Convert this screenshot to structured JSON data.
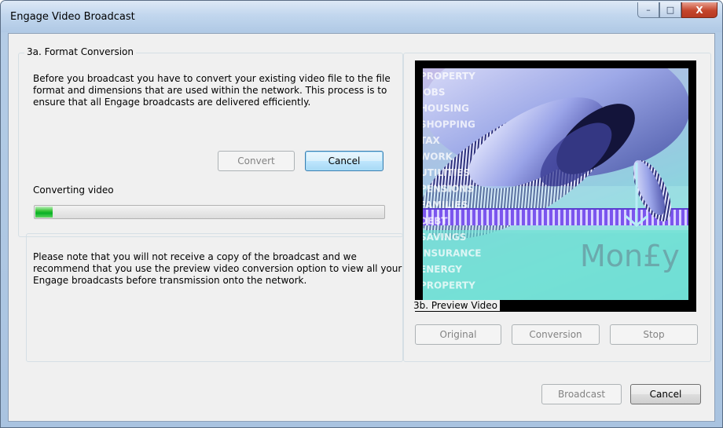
{
  "window": {
    "title": "Engage Video Broadcast",
    "controls": {
      "minimize": "–",
      "maximize": "□",
      "close": "X"
    }
  },
  "format_conversion": {
    "title": "3a. Format Conversion",
    "description": "Before you broadcast you have to convert your existing video file to the file format and dimensions that are used within the network. This process is to ensure that all Engage broadcasts are delivered efficiently.",
    "convert_label": "Convert",
    "cancel_label": "Cancel",
    "status_label": "Converting video",
    "progress_fraction": 0.05
  },
  "note": {
    "text": "Please note that you will not receive a copy of the broadcast and we recommend that you use the preview video conversion option to view all your Engage broadcasts before transmission onto the network."
  },
  "preview": {
    "title": "3b. Preview Video",
    "original_label": "Original",
    "conversion_label": "Conversion",
    "stop_label": "Stop",
    "frame_words": [
      "PROPERTY",
      "JOBS",
      "HOUSING",
      "SHOPPING",
      "TAX",
      "WORK",
      "UTILITIES",
      "PENSIONS",
      "FAMILIES",
      "DEBT",
      "SAVINGS",
      "INSURANCE",
      "ENERGY",
      "PROPERTY"
    ],
    "money_text": "Mon£y"
  },
  "footer": {
    "broadcast_label": "Broadcast",
    "cancel_label": "Cancel"
  },
  "colors": {
    "progress": "#06b025",
    "video_bg": "#6fe3d6",
    "stripe": "#8a5cf0"
  }
}
